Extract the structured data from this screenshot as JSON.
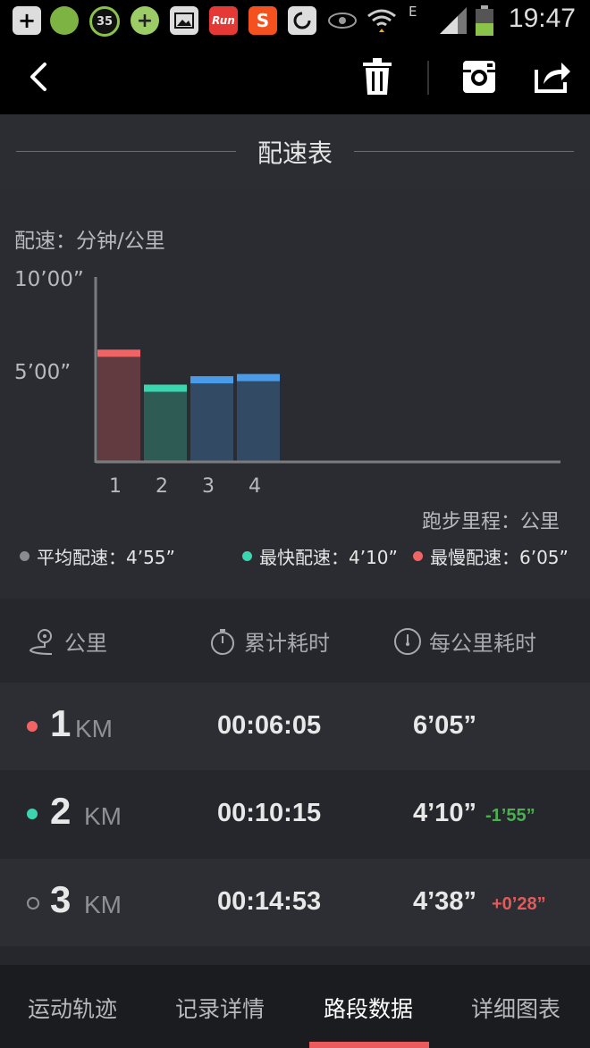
{
  "status_bar": {
    "time": "19:47",
    "notif_badge_35": "35",
    "network_type": "E",
    "icons": [
      "add-box-icon",
      "cartoon-app-icon",
      "timer-badge-icon",
      "plus-coin-icon",
      "gallery-icon",
      "run-app-icon",
      "sogou-app-icon",
      "refresh-app-icon",
      "eye-icon",
      "wifi-icon",
      "signal-icon",
      "battery-icon"
    ]
  },
  "app_bar": {
    "icons": [
      "back-icon",
      "trash-icon",
      "instagram-icon",
      "share-icon"
    ]
  },
  "section": {
    "title": "配速表"
  },
  "chart": {
    "y_unit_label": "配速：分钟/公里",
    "x_unit_label": "跑步里程：公里",
    "legend": [
      {
        "label": "平均配速：4’55”",
        "color": "#8a8b8e"
      },
      {
        "label": "最快配速：4’10”",
        "color": "#3ad6b0"
      },
      {
        "label": "最慢配速：6’05”",
        "color": "#f06466"
      }
    ]
  },
  "chart_data": {
    "type": "bar",
    "title": "",
    "ylabel": "配速：分钟/公里",
    "xlabel": "跑步里程：公里",
    "categories": [
      "1",
      "2",
      "3",
      "4"
    ],
    "values": [
      6.08,
      4.17,
      4.63,
      4.75
    ],
    "y_ticks": [
      "10’00”",
      "5’00”"
    ],
    "ylim": [
      0,
      10
    ],
    "bar_colors": [
      "#f06466",
      "#3ad6b0",
      "#4a9be8",
      "#4a9be8"
    ]
  },
  "table": {
    "headers": {
      "km": "公里",
      "elapsed": "累计耗时",
      "pace": "每公里耗时"
    },
    "rows": [
      {
        "km": "1",
        "unit": "KM",
        "elapsed": "00:06:05",
        "pace": "6’05”",
        "diff": "",
        "dot_color": "#f06466",
        "dot_style": "filled"
      },
      {
        "km": "2",
        "unit": "KM",
        "elapsed": "00:10:15",
        "pace": "4’10”",
        "diff": "-1’55”",
        "diff_color": "#4caf50",
        "dot_color": "#3ad6b0",
        "dot_style": "filled"
      },
      {
        "km": "3",
        "unit": "KM",
        "elapsed": "00:14:53",
        "pace": "4’38”",
        "diff": "+0’28”",
        "diff_color": "#e25b5b",
        "dot_color": "#8f9094",
        "dot_style": "hollow"
      }
    ]
  },
  "tabs": [
    {
      "label": "运动轨迹",
      "active": false
    },
    {
      "label": "记录详情",
      "active": false
    },
    {
      "label": "路段数据",
      "active": true
    },
    {
      "label": "详细图表",
      "active": false
    }
  ]
}
